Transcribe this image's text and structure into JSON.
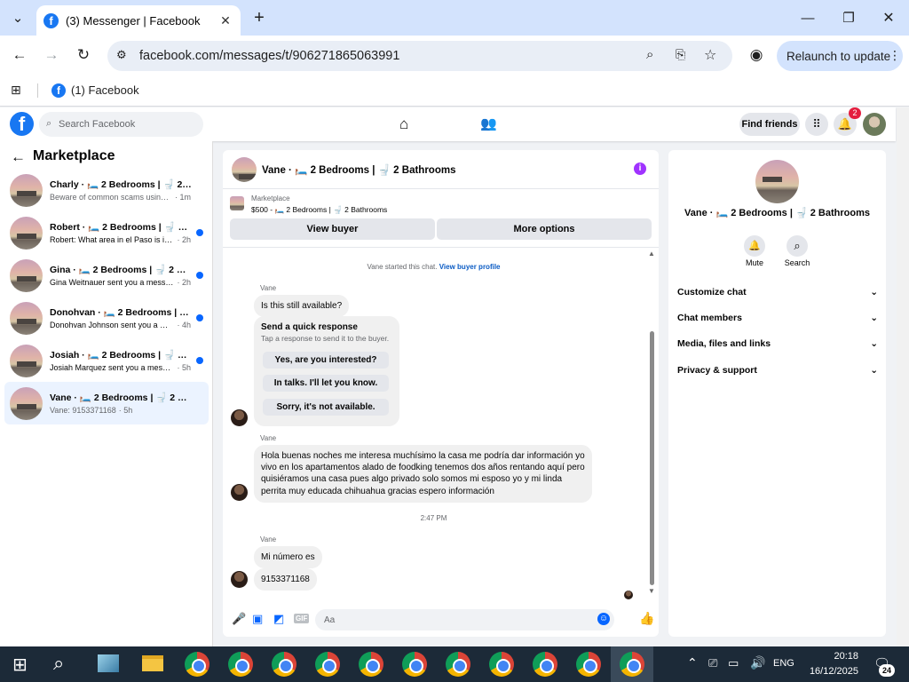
{
  "browser": {
    "tab_title": "(3) Messenger | Facebook",
    "url": "facebook.com/messages/t/906271865063991",
    "relaunch_label": "Relaunch to update",
    "bookmark": "(1) Facebook"
  },
  "fb": {
    "search_placeholder": "Search Facebook",
    "find_friends": "Find friends",
    "notif_count": "2"
  },
  "left": {
    "title": "Marketplace",
    "conversations": [
      {
        "name": "Charly · 🛏️ 2 Bedrooms | 🚽 2 Bathrooms",
        "preview": "Beware of common scams using pay...",
        "time": "· 1m",
        "unread": false
      },
      {
        "name": "Robert · 🛏️ 2 Bedrooms | 🚽 2 Bathrooms",
        "preview": "Robert: What area in el Paso is it lo...",
        "time": "· 2h",
        "unread": true
      },
      {
        "name": "Gina · 🛏️ 2 Bedrooms | 🚽 2 Bathrooms",
        "preview": "Gina Weitnauer sent you a messag...",
        "time": "· 2h",
        "unread": true
      },
      {
        "name": "Donohvan · 🛏️ 2 Bedrooms | 🚽 2 Bathrooms",
        "preview": "Donohvan Johnson sent you a mes...",
        "time": "· 4h",
        "unread": true
      },
      {
        "name": "Josiah · 🛏️ 2 Bedrooms | 🚽 2 Bathrooms",
        "preview": "Josiah Marquez sent you a messag...",
        "time": "· 5h",
        "unread": true
      },
      {
        "name": "Vane · 🛏️ 2 Bedrooms | 🚽 2 Bathrooms",
        "preview": "Vane: 9153371168",
        "time": "· 5h",
        "unread": false
      }
    ]
  },
  "chat": {
    "title": "Vane · 🛏️ 2 Bedrooms | 🚽 2 Bathrooms",
    "marketplace_label": "Marketplace",
    "listing": "$500 - 🛏️ 2 Bedrooms | 🚽 2 Bathrooms",
    "view_buyer": "View buyer",
    "more_options": "More options",
    "started": "Vane started this chat.",
    "view_profile": "View buyer profile",
    "sender": "Vane",
    "msg1": "Is this still available?",
    "qr_title": "Send a quick response",
    "qr_sub": "Tap a response to send it to the buyer.",
    "qr1": "Yes, are you interested?",
    "qr2": "In talks. I'll let you know.",
    "qr3": "Sorry, it's not available.",
    "msg2": "Hola buenas noches me interesa muchísimo la casa me podría dar información yo vivo en los apartamentos alado de foodking tenemos dos años rentando aquí pero quisiéramos una casa pues algo privado solo somos mi esposo yo y mi linda perrita muy educada chihuahua gracias espero información",
    "timestamp": "2:47 PM",
    "msg3": "Mi número es",
    "msg4": "9153371168",
    "input_placeholder": "Aa"
  },
  "right": {
    "title": "Vane · 🛏️ 2 Bedrooms | 🚽 2 Bathrooms",
    "mute": "Mute",
    "search": "Search",
    "rows": [
      "Customize chat",
      "Chat members",
      "Media, files and links",
      "Privacy & support"
    ]
  },
  "taskbar": {
    "lang": "ENG",
    "time": "20:18",
    "date": "16/12/2025",
    "badge": "24"
  }
}
